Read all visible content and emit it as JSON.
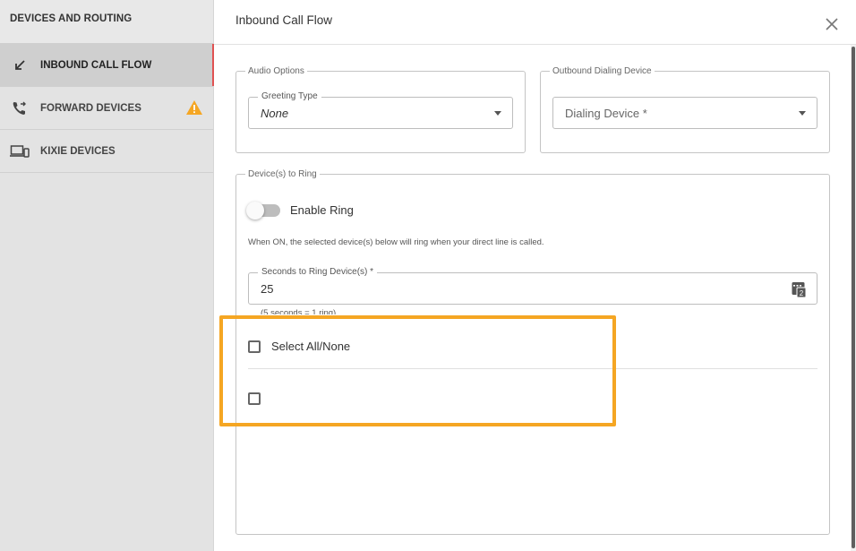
{
  "sidebar": {
    "header": "DEVICES AND ROUTING",
    "items": [
      {
        "label": "INBOUND CALL FLOW",
        "icon": "arrow-down-left-icon",
        "active": true
      },
      {
        "label": "FORWARD DEVICES",
        "icon": "phone-forward-icon",
        "warning": true
      },
      {
        "label": "KIXIE DEVICES",
        "icon": "devices-icon"
      }
    ]
  },
  "main": {
    "title": "Inbound Call Flow",
    "audio_options": {
      "legend": "Audio Options",
      "greeting_type": {
        "label": "Greeting Type",
        "value": "None"
      }
    },
    "outbound_device": {
      "legend": "Outbound Dialing Device",
      "placeholder": "Dialing Device *"
    },
    "devices_to_ring": {
      "legend": "Device(s) to Ring",
      "enable_ring_label": "Enable Ring",
      "enable_ring_on": false,
      "help_text": "When ON, the selected device(s) below will ring when your direct line is called.",
      "seconds_label": "Seconds to Ring Device(s) *",
      "seconds_value": "25",
      "seconds_hint": "(5 seconds = 1 ring)",
      "select_all_label": "Select All/None"
    }
  },
  "colors": {
    "accent_highlight": "#f5a623",
    "active_bar": "#e05252",
    "warning": "#f5a623"
  }
}
